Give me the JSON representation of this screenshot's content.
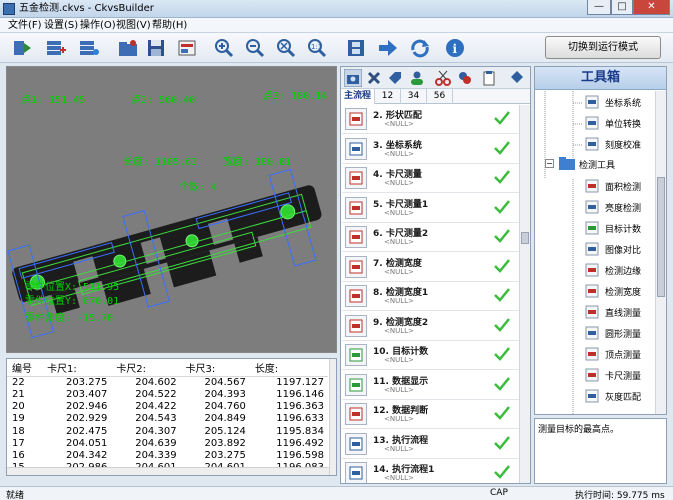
{
  "window": {
    "title": "五金检测.ckvs - CkvsBuilder",
    "min": "—",
    "max": "□",
    "close": "✕"
  },
  "menu": [
    "文件(F)",
    "设置(S)",
    "操作(O)",
    "视图(V)",
    "帮助(H)"
  ],
  "toolbar": {
    "icons": [
      "open-icon",
      "save-all-icon",
      "settings-list-icon",
      "open-folder-icon",
      "save-icon",
      "camera-capture-icon",
      "zoom-in-icon",
      "zoom-out-icon",
      "zoom-fit-icon",
      "zoom-actual-icon",
      "film-icon",
      "arrow-right-icon",
      "loop-icon",
      "info-icon"
    ],
    "run_mode_button": "切换到运行模式"
  },
  "viewer": {
    "overlays": {
      "pt1": "点1: 151.45",
      "pt2": "点2: 560.40",
      "pt3": "点3: 180.14",
      "length": "长度: 1185.63",
      "width": "宽度: 180.81",
      "count": "个数: 4",
      "pos_x": "零件位置X: 511.95",
      "pos_y": "零件位置Y: 670.01",
      "angle": "零件角度: -15.70"
    }
  },
  "data_table": {
    "headers": [
      "编号",
      "卡尺1:",
      "卡尺2:",
      "卡尺3:",
      "长度:"
    ],
    "rows": [
      [
        "22",
        "203.275",
        "204.602",
        "204.567",
        "1197.127"
      ],
      [
        "21",
        "203.407",
        "204.522",
        "204.393",
        "1196.146"
      ],
      [
        "20",
        "202.946",
        "204.422",
        "204.760",
        "1196.363"
      ],
      [
        "19",
        "202.929",
        "204.543",
        "204.849",
        "1196.633"
      ],
      [
        "18",
        "202.475",
        "204.307",
        "205.124",
        "1195.834"
      ],
      [
        "17",
        "204.051",
        "204.639",
        "203.892",
        "1196.492"
      ],
      [
        "16",
        "204.342",
        "204.339",
        "203.275",
        "1196.598"
      ],
      [
        "15",
        "202.986",
        "204.601",
        "204.601",
        "1196.083"
      ]
    ]
  },
  "process": {
    "tabs": [
      "主流程",
      "12",
      "34",
      "56"
    ],
    "toolbar_icons": [
      "camera-icon",
      "delete-icon",
      "tag-icon",
      "user-icon",
      "cut-icon",
      "paste-icon",
      "clipboard-icon",
      "pin-icon"
    ],
    "steps": [
      {
        "name": "2. 形状匹配",
        "sub": "<NULL>",
        "icon": "shape-match-icon"
      },
      {
        "name": "3. 坐标系统",
        "sub": "<NULL>",
        "icon": "coordinate-icon"
      },
      {
        "name": "4. 卡尺测量",
        "sub": "<NULL>",
        "icon": "caliper-icon"
      },
      {
        "name": "5. 卡尺测量1",
        "sub": "<NULL>",
        "icon": "caliper-icon"
      },
      {
        "name": "6. 卡尺测量2",
        "sub": "<NULL>",
        "icon": "caliper-icon"
      },
      {
        "name": "7. 检测宽度",
        "sub": "<NULL>",
        "icon": "width-icon"
      },
      {
        "name": "8. 检测宽度1",
        "sub": "<NULL>",
        "icon": "width-icon"
      },
      {
        "name": "9. 检测宽度2",
        "sub": "<NULL>",
        "icon": "width-icon"
      },
      {
        "name": "10. 目标计数",
        "sub": "<NULL>",
        "icon": "count-icon"
      },
      {
        "name": "11. 数据显示",
        "sub": "<NULL>",
        "icon": "display-icon"
      },
      {
        "name": "12. 数据判断",
        "sub": "<NULL>",
        "icon": "judge-icon"
      },
      {
        "name": "13. 执行流程",
        "sub": "<NULL>",
        "icon": "run-icon"
      },
      {
        "name": "14. 执行流程1",
        "sub": "<NULL>",
        "icon": "run-icon"
      }
    ]
  },
  "toolbox": {
    "title": "工具箱",
    "tools_top": [
      "坐标系统",
      "单位转换",
      "刻度校准"
    ],
    "group": "检测工具",
    "tools": [
      "面积检测",
      "亮度检测",
      "目标计数",
      "图像对比",
      "检测边缘",
      "检测宽度",
      "直线测量",
      "圆形测量",
      "顶点测量",
      "卡尺测量",
      "灰度匹配"
    ],
    "description": "测量目标的最高点。"
  },
  "status": {
    "left": "就绪",
    "cap": "CAP",
    "time": "执行时间: 59.775 ms"
  },
  "colors": {
    "overlay_green": "#00d000",
    "check_green": "#3cbc3c",
    "accent_blue": "#1b3b8a"
  }
}
